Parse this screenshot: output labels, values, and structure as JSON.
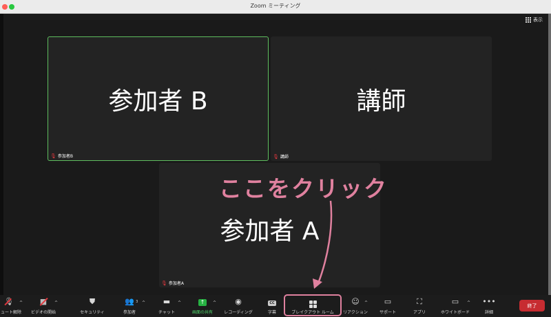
{
  "window": {
    "title": "Zoom ミーティング"
  },
  "view_button": {
    "label": "表示",
    "icon": "grid-icon"
  },
  "tiles": [
    {
      "name": "参加者 B",
      "label": "参加者B",
      "active": true
    },
    {
      "name": "講師",
      "label": "講師",
      "active": false
    },
    {
      "name": "参加者 A",
      "label": "参加者A",
      "active": false
    }
  ],
  "annotation": {
    "text": "ここをクリック",
    "color": "#e0819f"
  },
  "toolbar": {
    "unmute": "ミュート解除",
    "video": "ビデオの開始",
    "security": "セキュリティ",
    "participants": "参加者",
    "participants_count": "3",
    "chat": "チャット",
    "share": "画面の共有",
    "recording": "レコーディング",
    "captions": "字幕",
    "captions_icon": "CC",
    "breakout": "ブレイクアウト ルーム",
    "reactions": "リアクション",
    "support": "サポート",
    "apps": "アプリ",
    "whiteboard": "ホワイトボード",
    "more": "詳細",
    "end": "終了"
  },
  "colors": {
    "active_border": "#5fbf5f",
    "end_button": "#c72c31",
    "share_green": "#27b243",
    "mute_red": "#e0383e"
  }
}
